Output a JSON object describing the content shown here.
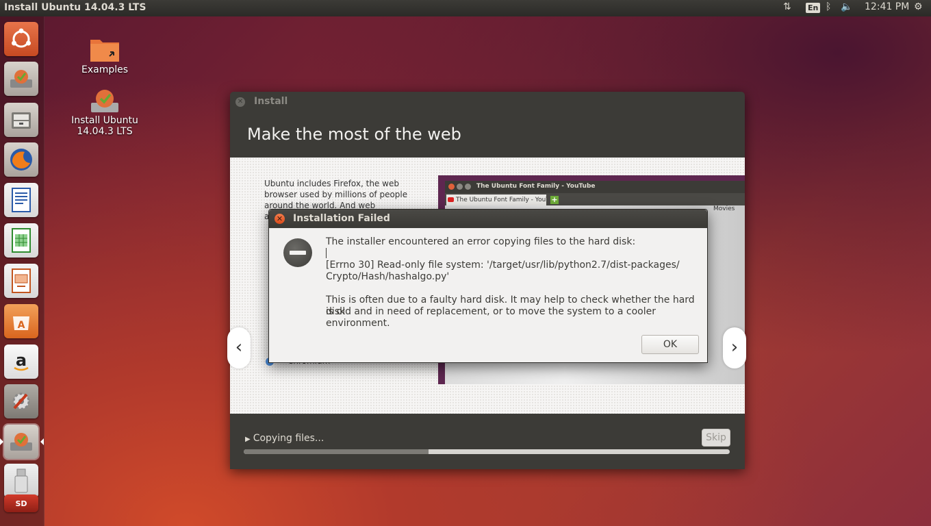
{
  "top_panel": {
    "title": "Install Ubuntu 14.04.3 LTS",
    "keyboard_layout": "En",
    "clock": "12:41 PM"
  },
  "launcher": {
    "items": [
      {
        "name": "dash-home-icon"
      },
      {
        "name": "install-ubuntu-icon"
      },
      {
        "name": "files-icon"
      },
      {
        "name": "firefox-icon"
      },
      {
        "name": "libreoffice-writer-icon"
      },
      {
        "name": "libreoffice-calc-icon"
      },
      {
        "name": "libreoffice-impress-icon"
      },
      {
        "name": "ubuntu-software-center-icon"
      },
      {
        "name": "amazon-icon"
      },
      {
        "name": "system-settings-icon"
      },
      {
        "name": "install-ubuntu-running-icon"
      },
      {
        "name": "usb-drive-icon"
      },
      {
        "name": "sd-card-icon"
      }
    ],
    "sd_label": "SD"
  },
  "desktop": {
    "icons": [
      {
        "label": "Examples"
      },
      {
        "label_line1": "Install Ubuntu",
        "label_line2": "14.04.3 LTS"
      }
    ]
  },
  "installer": {
    "window_title": "Install",
    "heading": "Make the most of the web",
    "slide_text_lines": [
      "Ubuntu includes Firefox, the web",
      "browser used by millions of people",
      "around the world. And web applications"
    ],
    "slide_fragment_chromium": "Chromium",
    "browser_mock": {
      "title": "The Ubuntu Font Family - YouTube",
      "tab": "The Ubuntu Font Family - YouT...",
      "nav_item": "Movies"
    },
    "status": "Copying files...",
    "skip_label": "Skip",
    "progress": 0.38
  },
  "dialog": {
    "title": "Installation Failed",
    "line1": "The installer encountered an error copying files to the hard disk:",
    "line2": "[Errno 30] Read-only file system: '/target/usr/lib/python2.7/dist-packages/",
    "line3": "Crypto/Hash/hashalgo.py'",
    "line4": "This is often due to a faulty hard disk. It may help to check whether the hard disk",
    "line5": "is old and in need of replacement, or to move the system to a cooler environment.",
    "ok_label": "OK"
  },
  "colors": {
    "panel": "#3c3b37",
    "accent_orange": "#dd4814",
    "dialog_bg": "#f2f1f0"
  }
}
